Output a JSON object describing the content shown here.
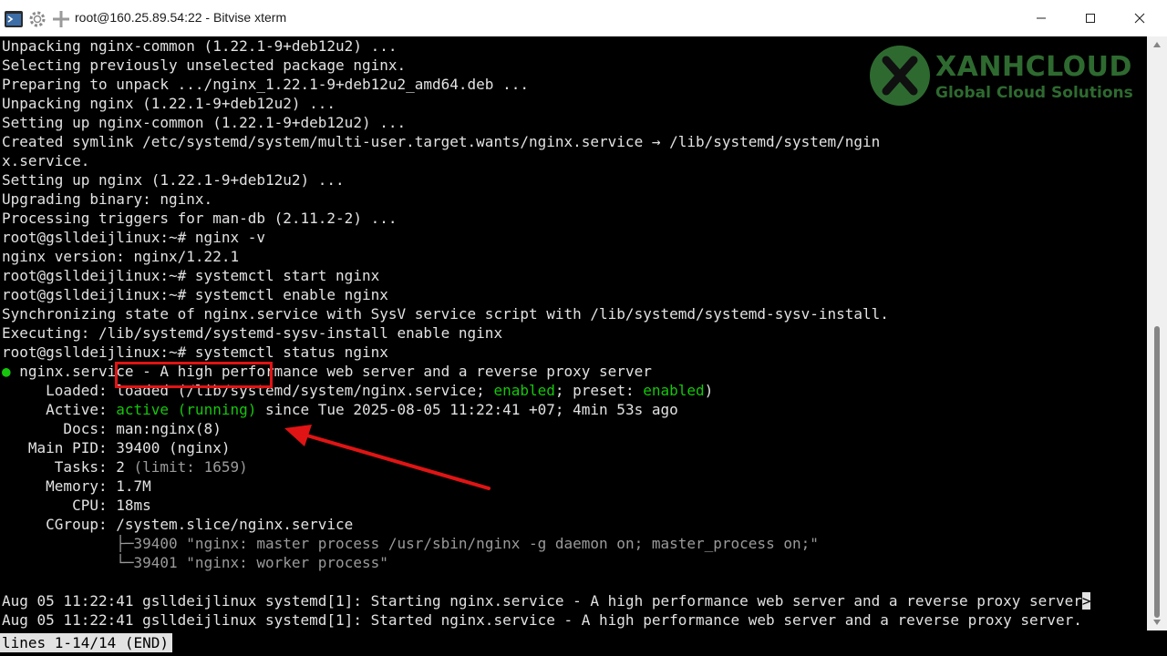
{
  "window": {
    "title": "root@160.25.89.54:22 - Bitvise xterm",
    "app_icon": "terminal-app-icon",
    "settings_icon": "gear-icon",
    "new_icon": "plus-icon"
  },
  "terminal": {
    "lines": [
      {
        "plain": "Unpacking nginx-common (1.22.1-9+deb12u2) ..."
      },
      {
        "plain": "Selecting previously unselected package nginx."
      },
      {
        "plain": "Preparing to unpack .../nginx_1.22.1-9+deb12u2_amd64.deb ..."
      },
      {
        "plain": "Unpacking nginx (1.22.1-9+deb12u2) ..."
      },
      {
        "plain": "Setting up nginx-common (1.22.1-9+deb12u2) ..."
      },
      {
        "plain": "Created symlink /etc/systemd/system/multi-user.target.wants/nginx.service → /lib/systemd/system/ngin"
      },
      {
        "plain": "x.service."
      },
      {
        "plain": "Setting up nginx (1.22.1-9+deb12u2) ..."
      },
      {
        "plain": "Upgrading binary: nginx."
      },
      {
        "plain": "Processing triggers for man-db (2.11.2-2) ..."
      },
      {
        "plain": "root@gslldeijlinux:~# nginx -v"
      },
      {
        "plain": "nginx version: nginx/1.22.1"
      },
      {
        "plain": "root@gslldeijlinux:~# systemctl start nginx"
      },
      {
        "plain": "root@gslldeijlinux:~# systemctl enable nginx"
      },
      {
        "plain": "Synchronizing state of nginx.service with SysV service script with /lib/systemd/systemd-sysv-install."
      },
      {
        "plain": "Executing: /lib/systemd/systemd-sysv-install enable nginx"
      },
      {
        "plain": "root@gslldeijlinux:~# systemctl status nginx"
      }
    ],
    "status": {
      "bullet": "●",
      "header": " nginx.service - A high performance web server and a reverse proxy server",
      "loaded_label": "     Loaded: ",
      "loaded_a": "loaded (/lib/systemd/system/nginx.service; ",
      "loaded_enabled": "enabled",
      "loaded_b": "; preset: ",
      "loaded_preset": "enabled",
      "loaded_c": ")",
      "active_label": "     Active: ",
      "active_state": "active (running)",
      "active_since": " since Tue 2025-08-05 11:22:41 +07; 4min 53s ago",
      "docs": "       Docs: man:nginx(8)",
      "mainpid": "   Main PID: 39400 (nginx)",
      "tasks_label": "      Tasks: 2 ",
      "tasks_limit": "(limit: 1659)",
      "memory": "     Memory: 1.7M",
      "cpu": "        CPU: 18ms",
      "cgroup": "     CGroup: /system.slice/nginx.service",
      "proc1_tree": "             ├─",
      "proc1": "39400 \"nginx: master process /usr/sbin/nginx -g daemon on; master_process on;\"",
      "proc2_tree": "             └─",
      "proc2": "39401 \"nginx: worker process\"",
      "log1": "Aug 05 11:22:41 gslldeijlinux systemd[1]: Starting nginx.service - A high performance web server and a reverse proxy server",
      "log1_more": ">",
      "log2": "Aug 05 11:22:41 gslldeijlinux systemd[1]: Started nginx.service - A high performance web server and a reverse proxy server."
    },
    "pager_status": "lines 1-14/14 (END)"
  },
  "watermark": {
    "brand": "XANHCLOUD",
    "tagline": "Global Cloud Solutions"
  },
  "colors": {
    "terminal_bg": "#000000",
    "text": "#e2e2e2",
    "green": "#16c60c",
    "annotation_red": "#e01414"
  }
}
